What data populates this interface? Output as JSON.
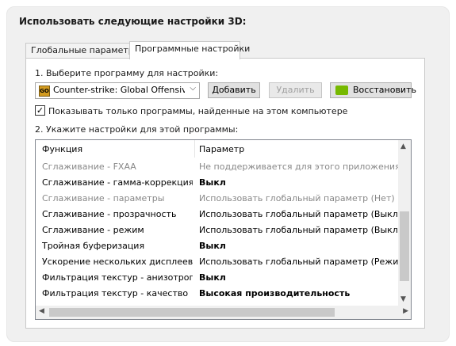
{
  "heading": "Использовать следующие настройки 3D:",
  "tabs": [
    {
      "label": "Глобальные параметры"
    },
    {
      "label": "Программные настройки"
    }
  ],
  "step1_label": "1. Выберите программу для настройки:",
  "program_select": {
    "value": "Counter-strike: Global Offensiv...",
    "icon": "csgo-app-icon"
  },
  "buttons": {
    "add": "Добавить",
    "remove": "Удалить",
    "restore": "Восстановить"
  },
  "show_only_checkbox": {
    "label": "Показывать только программы, найденные на этом компьютере",
    "checked": true
  },
  "step2_label": "2. Укажите настройки для этой программы:",
  "table": {
    "headers": [
      "Функция",
      "Параметр"
    ],
    "rows": [
      {
        "feature": "Сглаживание - FXAA",
        "value": "Не поддерживается для этого приложения"
      },
      {
        "feature": "Сглаживание - гамма-коррекция",
        "value": "Выкл"
      },
      {
        "feature": "Сглаживание - параметры",
        "value": "Использовать глобальный параметр (Нет)"
      },
      {
        "feature": "Сглаживание - прозрачность",
        "value": "Использовать глобальный параметр (Выкл)"
      },
      {
        "feature": "Сглаживание - режим",
        "value": "Использовать глобальный параметр (Выкл)"
      },
      {
        "feature": "Тройная буферизация",
        "value": "Выкл"
      },
      {
        "feature": "Ускорение нескольких дисплеев/...",
        "value": "Использовать глобальный параметр (Режим многодисплейной производительности)"
      },
      {
        "feature": "Фильтрация текстур - анизотропн...",
        "value": "Выкл"
      },
      {
        "feature": "Фильтрация текстур - качество",
        "value": "Высокая производительность"
      }
    ]
  }
}
